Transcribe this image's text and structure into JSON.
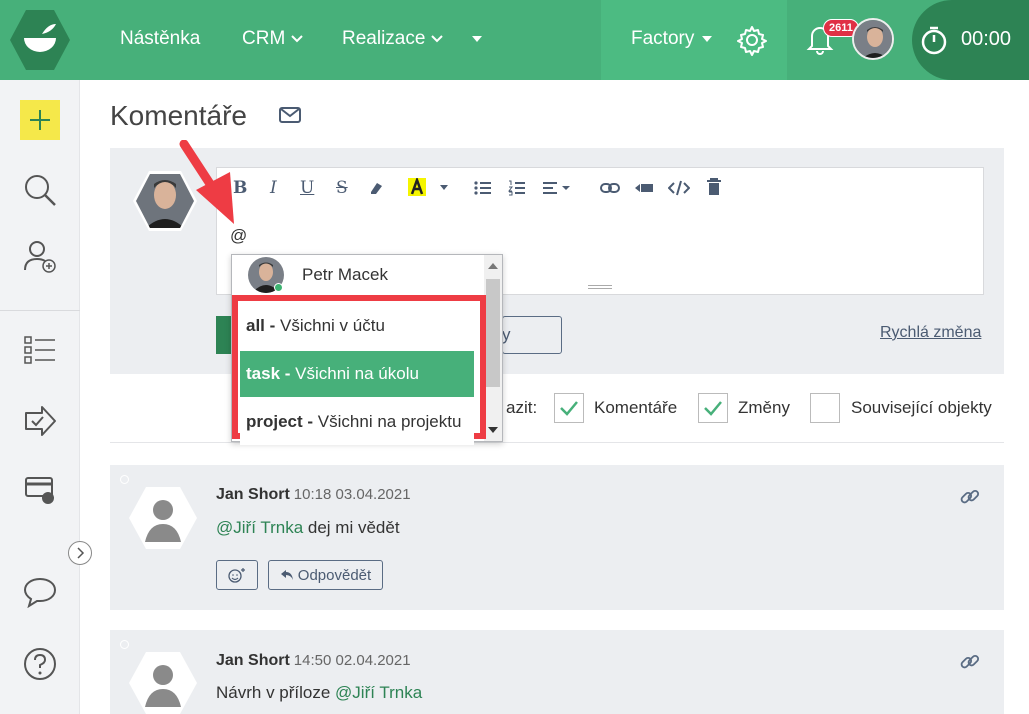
{
  "nav": {
    "items": [
      {
        "label": "Nástěnka",
        "caret": false
      },
      {
        "label": "CRM",
        "caret": true
      },
      {
        "label": "Realizace",
        "caret": true
      }
    ],
    "more_caret": true,
    "factory_label": "Factory",
    "notifications_count": "2611",
    "timer": "00:00"
  },
  "page": {
    "title": "Komentáře"
  },
  "editor": {
    "text": "@",
    "quick_change": "Rychlá změna",
    "split_button_partial": "y"
  },
  "mention_dropdown": {
    "user": "Petr Macek",
    "items": [
      {
        "key": "all",
        "sep": " - ",
        "desc": "Všichni v účtu",
        "active": false
      },
      {
        "key": "task",
        "sep": " - ",
        "desc": "Všichni na úkolu",
        "active": true
      },
      {
        "key": "project",
        "sep": " - ",
        "desc": "Všichni na projektu",
        "active": false
      }
    ]
  },
  "filters": {
    "label_partial": "azit:",
    "options": [
      {
        "label": "Komentáře",
        "checked": true
      },
      {
        "label": "Změny",
        "checked": true
      },
      {
        "label": "Související objekty",
        "checked": false
      }
    ]
  },
  "comments": [
    {
      "author": "Jan Short",
      "time": "10:18 03.04.2021",
      "text_before": "",
      "mention": "@Jiří Trnka",
      "text_after": " dej mi vědět",
      "reply_label": "Odpovědět"
    },
    {
      "author": "Jan Short",
      "time": "14:50 02.04.2021",
      "text_before": "Návrh v příloze ",
      "mention": "@Jiří Trnka",
      "text_after": ""
    }
  ],
  "colors": {
    "brand_green": "#47b07a",
    "dark_green": "#2d8354",
    "highlight_red": "#ee3c44",
    "badge_red": "#e03045",
    "add_yellow": "#f5e84a"
  },
  "icons": [
    "logo-icon",
    "settings-gear-icon",
    "bell-icon",
    "stopwatch-icon",
    "plus-icon",
    "search-icon",
    "add-user-icon",
    "task-list-icon",
    "forward-check-icon",
    "billing-card-icon",
    "chat-bubble-icon",
    "help-icon",
    "mail-icon",
    "link-icon",
    "emoji-add-icon",
    "reply-icon"
  ]
}
